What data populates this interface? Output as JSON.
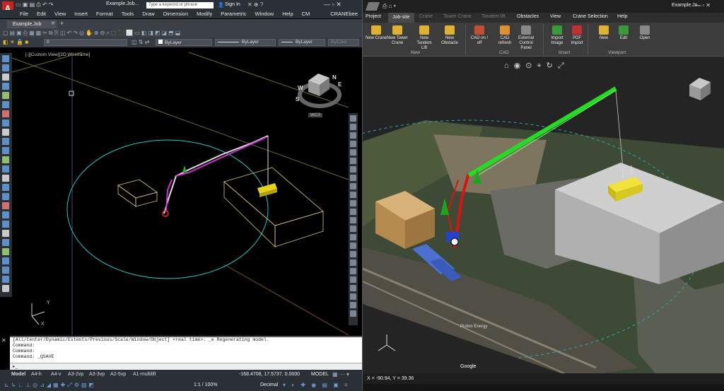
{
  "autocad": {
    "title": "Example.Job...",
    "search_placeholder": "Type a keyword or phrase",
    "sign_in": "Sign In",
    "menu": [
      "File",
      "Edit",
      "View",
      "Insert",
      "Format",
      "Tools",
      "Draw",
      "Dimension",
      "Modify",
      "Parametric",
      "Window",
      "Help",
      "CM 2014",
      "CRANEbee"
    ],
    "doc_tab": "Example.Job",
    "layer_value": "0",
    "color_value": "ByLayer",
    "linetype_value": "ByLayer",
    "lineweight_value": "ByLayer",
    "plotstyle_value": "ByColor",
    "view_label": "[-][Custom View][2D Wireframe]",
    "viewcube": {
      "n": "N",
      "w": "W",
      "e": "E",
      "s": "S",
      "face": "TOP",
      "wcs": "WCS"
    },
    "ucs": {
      "x": "X",
      "y": "Y"
    },
    "command_lines": [
      "[All/Center/Dynamic/Extents/Previous/Scale/Window/Object] <real time>: _e Regenerating model.",
      "Command:",
      "Command:",
      "Command:  _QSAVE"
    ],
    "command_input": "",
    "layout_tabs": [
      "Model",
      "A4-h",
      "A4-v",
      "A3-2vp",
      "A3-3vp",
      "A2-5vp",
      "A1-multilift"
    ],
    "coords": "-168.4708, 17.5737, 0.0000",
    "model_label": "MODEL",
    "scale": "1:1 / 100%",
    "units": "Decimal"
  },
  "cranebee": {
    "title": "Example.Jo...",
    "tabs": [
      {
        "label": "Project",
        "state": "normal"
      },
      {
        "label": "Job-site",
        "state": "active"
      },
      {
        "label": "Crane",
        "state": "dim"
      },
      {
        "label": "Tower Crane",
        "state": "dim"
      },
      {
        "label": "Tandem lift",
        "state": "dim"
      },
      {
        "label": "Obstacles",
        "state": "normal"
      },
      {
        "label": "View",
        "state": "normal"
      },
      {
        "label": "Crane Selection",
        "state": "normal"
      },
      {
        "label": "Help",
        "state": "normal"
      }
    ],
    "ribbon_buttons": [
      {
        "label": "New Crane"
      },
      {
        "label": "New Tower Crane"
      },
      {
        "label": "New Tandem Lift"
      },
      {
        "label": "New Obstacle"
      },
      {
        "label": "CAD on / off"
      },
      {
        "label": "CAD refresh"
      },
      {
        "label": "External Control Panel"
      },
      {
        "label": "Import Image"
      },
      {
        "label": "PDF Import"
      },
      {
        "label": "New"
      },
      {
        "label": "Edit"
      },
      {
        "label": "Open"
      }
    ],
    "groups": {
      "new": "New",
      "cad": "CAD",
      "insert": "Insert",
      "viewport": "Viewport"
    },
    "map_labels": {
      "google": "Google",
      "company": "Proton Energy"
    },
    "coordinates": "X = -90.94, Y = 39.36",
    "colors": {
      "crane_jib": "#22dd22",
      "crane_mast": "#e01010",
      "load": "#e6d21a",
      "building": "#b9b9b9"
    }
  }
}
